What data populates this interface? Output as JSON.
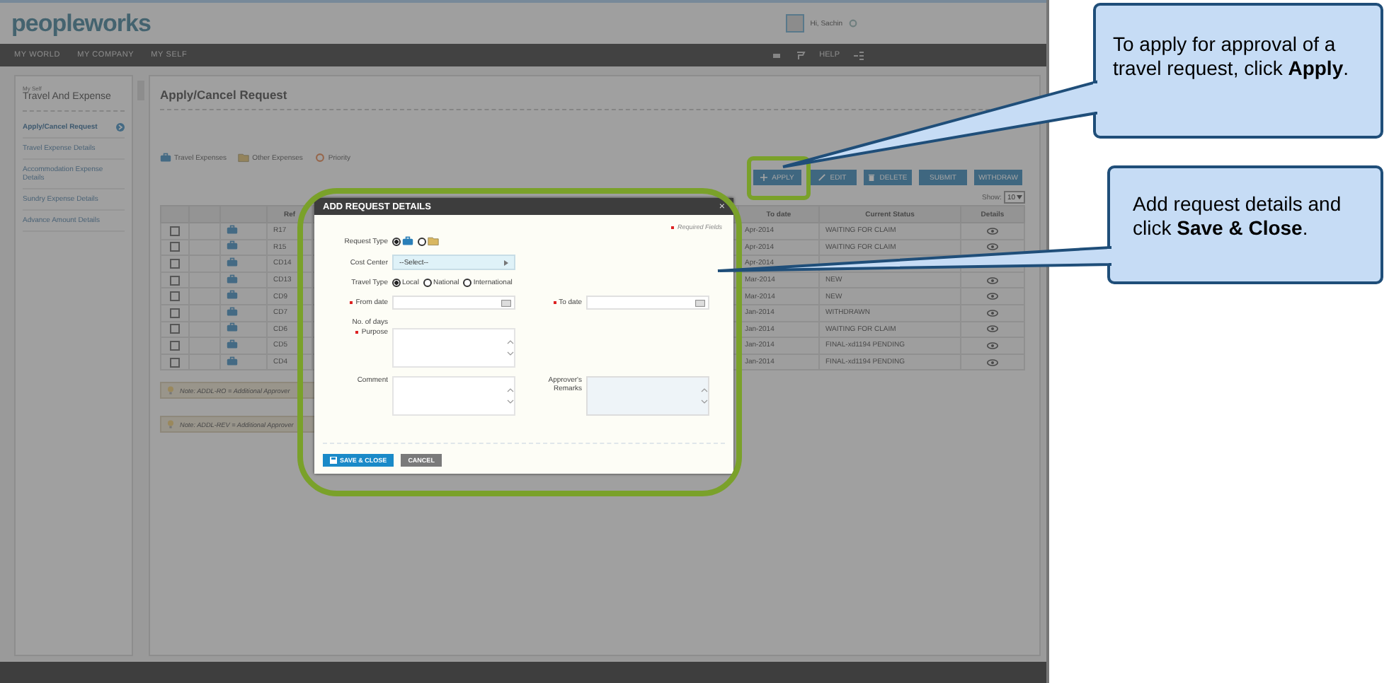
{
  "header": {
    "logo": "peopleworks",
    "greeting": "Hi, Sachin"
  },
  "nav": {
    "items": [
      {
        "label": "MY WORLD"
      },
      {
        "label": "MY COMPANY"
      },
      {
        "label": "MY SELF"
      }
    ],
    "help": "HELP"
  },
  "sidebar": {
    "section": "My Self",
    "title": "Travel And Expense",
    "items": [
      {
        "label": "Apply/Cancel Request",
        "selected": true
      },
      {
        "label": "Travel Expense Details",
        "selected": false
      },
      {
        "label": "Accommodation Expense Details",
        "selected": false
      },
      {
        "label": "Sundry Expense Details",
        "selected": false
      },
      {
        "label": "Advance Amount Details",
        "selected": false
      }
    ]
  },
  "page_title": "Apply/Cancel Request",
  "legend": [
    {
      "kind": "briefcase",
      "label": "Travel Expenses"
    },
    {
      "kind": "folder",
      "label": "Other Expenses"
    },
    {
      "kind": "priority",
      "label": "Priority"
    }
  ],
  "toolbar": {
    "buttons": [
      {
        "kind": "plus",
        "label": "APPLY"
      },
      {
        "kind": "pencil",
        "label": "EDIT"
      },
      {
        "kind": "trash",
        "label": "DELETE"
      },
      {
        "kind": "none",
        "label": "SUBMIT"
      },
      {
        "kind": "none",
        "label": "WITHDRAW"
      }
    ],
    "show_label": "Show:",
    "show_value": "10"
  },
  "table": {
    "columns": [
      {
        "label": "Ref"
      },
      {
        "label": "To date"
      },
      {
        "label": "Current Status"
      },
      {
        "label": "Details"
      }
    ],
    "rows": [
      {
        "checked": false,
        "ref": "R17",
        "to_date": "Apr-2014",
        "status": "WAITING FOR CLAIM"
      },
      {
        "checked": false,
        "ref": "R15",
        "to_date": "Apr-2014",
        "status": "WAITING FOR CLAIM"
      },
      {
        "checked": false,
        "ref": "CD14",
        "to_date": "Apr-2014"
      },
      {
        "checked": false,
        "ref": "CD13",
        "to_date": "Mar-2014",
        "status": "NEW"
      },
      {
        "checked": false,
        "ref": "CD9",
        "to_date": "Mar-2014",
        "status": "NEW"
      },
      {
        "checked": false,
        "ref": "CD7",
        "to_date": "Jan-2014",
        "status": "WITHDRAWN"
      },
      {
        "checked": false,
        "ref": "CD6",
        "to_date": "Jan-2014",
        "status": "WAITING FOR CLAIM"
      },
      {
        "checked": false,
        "ref": "CD5",
        "to_date": "Jan-2014",
        "status": "FINAL-xd1194 PENDING"
      },
      {
        "checked": false,
        "ref": "CD4",
        "to_date": "Jan-2014",
        "status": "FINAL-xd1194 PENDING"
      }
    ]
  },
  "notes": [
    "Note: ADDL-RO = Additional Approver",
    "Note: ADDL-REV = Additional Approver"
  ],
  "modal": {
    "title": "ADD REQUEST DETAILS",
    "close": "×",
    "required_note": "Required Fields",
    "request_type": {
      "label": "Request Type",
      "options": [
        {
          "kind": "briefcase",
          "selected": true
        },
        {
          "kind": "folder",
          "selected": false
        }
      ]
    },
    "cost_center": {
      "label": "Cost Center",
      "value": "--Select--"
    },
    "travel_type": {
      "label": "Travel Type",
      "options": [
        {
          "label": "Local",
          "selected": true
        },
        {
          "label": "National",
          "selected": false
        },
        {
          "label": "International",
          "selected": false
        }
      ]
    },
    "from_date": {
      "label": "From date",
      "required": true
    },
    "to_date": {
      "label": "To date",
      "required": true
    },
    "days": {
      "label": "No. of days"
    },
    "purpose": {
      "label": "Purpose",
      "required": true
    },
    "comment": {
      "label": "Comment"
    },
    "remarks": {
      "label": "Approver's Remarks"
    },
    "buttons": [
      {
        "kind": "primary",
        "label": "SAVE & CLOSE"
      },
      {
        "kind": "secondary",
        "label": "CANCEL"
      }
    ]
  },
  "callouts": [
    {
      "text": "To apply for approval of a travel request, click **Apply**."
    },
    {
      "text": "Add request details and click **Save & Close**."
    }
  ]
}
